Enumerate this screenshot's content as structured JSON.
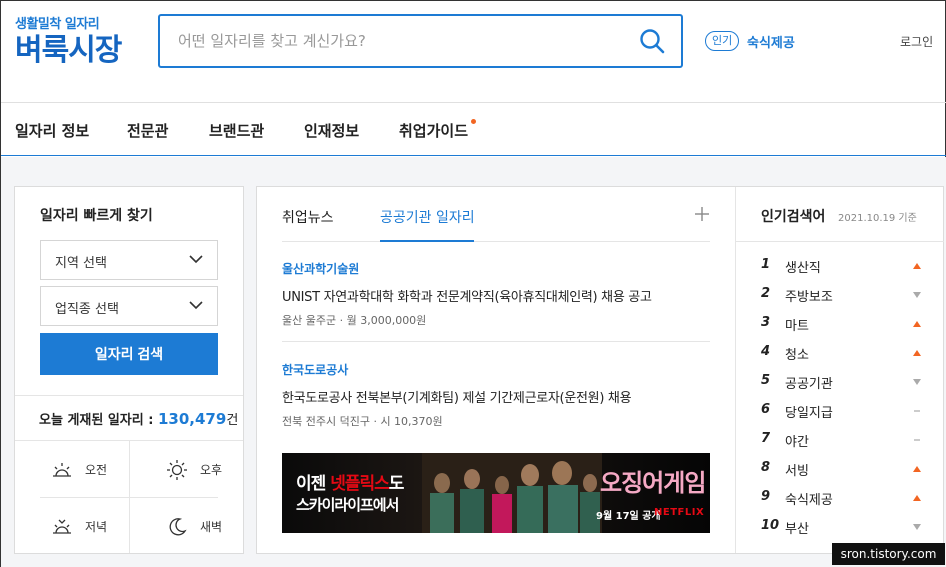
{
  "header": {
    "logo_sub": "생활밀착 일자리",
    "logo_main": "벼룩시장",
    "search_placeholder": "어떤 일자리를 찾고 계신가요?",
    "popular_badge": "인기",
    "popular_keyword": "숙식제공",
    "login": "로그인"
  },
  "nav": {
    "items": [
      "일자리 정보",
      "전문관",
      "브랜드관",
      "인재정보",
      "취업가이드"
    ]
  },
  "left": {
    "title": "일자리 빠르게 찾기",
    "region_select": "지역 선택",
    "job_select": "업직종 선택",
    "search_button": "일자리 검색",
    "today_label": "오늘 게재된 일자리 : ",
    "today_count": "130,479",
    "today_unit": "건",
    "times": [
      "오전",
      "오후",
      "저녁",
      "새벽"
    ]
  },
  "middle": {
    "tabs": [
      "취업뉴스",
      "공공기관 일자리"
    ],
    "news": [
      {
        "org": "울산과학기술원",
        "title": "UNIST 자연과학대학 화학과 전문계약직(육아휴직대체인력) 채용 공고",
        "meta": "울산 울주군 · 월 3,000,000원"
      },
      {
        "org": "한국도로공사",
        "title": "한국도로공사 전북본부(기계화팀) 제설 기간제근로자(운전원) 채용",
        "meta": "전북 전주시 덕진구 · 시 10,370원"
      }
    ],
    "banner": {
      "line1_pre": "이젠 ",
      "line1_red": "넷플릭스",
      "line1_post": "도",
      "line2": "스카이라이프에서",
      "game": "오징어게임",
      "date": "9월 17일 공개",
      "brand": "NETFLIX"
    }
  },
  "ranking": {
    "title": "인기검색어",
    "date": "2021.10.19 기준",
    "items": [
      {
        "rank": "1",
        "word": "생산직",
        "trend": "up"
      },
      {
        "rank": "2",
        "word": "주방보조",
        "trend": "down"
      },
      {
        "rank": "3",
        "word": "마트",
        "trend": "up"
      },
      {
        "rank": "4",
        "word": "청소",
        "trend": "up"
      },
      {
        "rank": "5",
        "word": "공공기관",
        "trend": "down"
      },
      {
        "rank": "6",
        "word": "당일지급",
        "trend": "same"
      },
      {
        "rank": "7",
        "word": "야간",
        "trend": "same"
      },
      {
        "rank": "8",
        "word": "서빙",
        "trend": "up"
      },
      {
        "rank": "9",
        "word": "숙식제공",
        "trend": "up"
      },
      {
        "rank": "10",
        "word": "부산",
        "trend": "down"
      }
    ]
  },
  "colors": {
    "brand": "#1d7bd4",
    "up": "#f26522",
    "down": "#aaaaaa"
  },
  "watermark": "sron.tistory.com"
}
